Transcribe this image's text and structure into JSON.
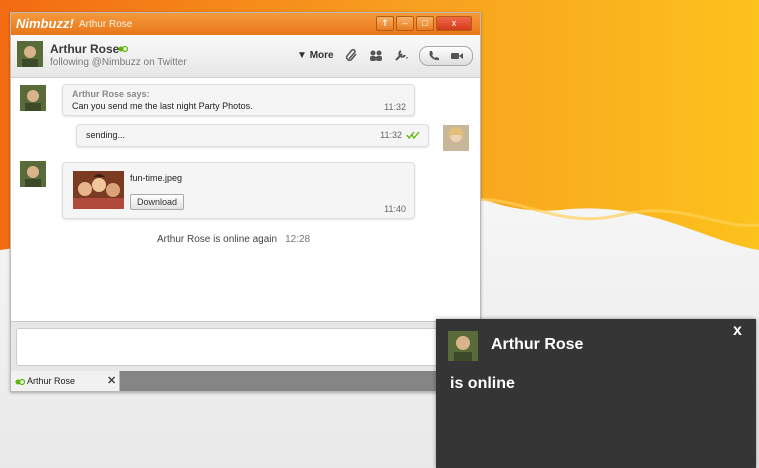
{
  "window": {
    "brand": "Nimbuzz!",
    "title": "Arthur Rose",
    "buttons": {
      "pin": "⇑",
      "minimize": "–",
      "maximize": "□",
      "close": "x"
    }
  },
  "header": {
    "contact_name": "Arthur Rose",
    "subtitle": "following @Nimbuzz on Twitter",
    "more_label": "More",
    "status_color": "#5cb800"
  },
  "messages": [
    {
      "sender_label": "Arthur Rose says:",
      "text": "Can you send me the last night Party Photos.",
      "time": "11:32"
    },
    {
      "text": "sending...",
      "time": "11:32"
    },
    {
      "file_name": "fun-time.jpeg",
      "button_label": "Download",
      "time": "11:40"
    }
  ],
  "system_message": {
    "text": "Arthur Rose is online again",
    "time": "12:28"
  },
  "tabs": [
    {
      "label": "Arthur Rose"
    }
  ],
  "notification": {
    "name": "Arthur Rose",
    "status": "is online",
    "close_label": "x"
  },
  "colors": {
    "accent_orange": "#f07d1b",
    "notification_bg": "#353535"
  }
}
